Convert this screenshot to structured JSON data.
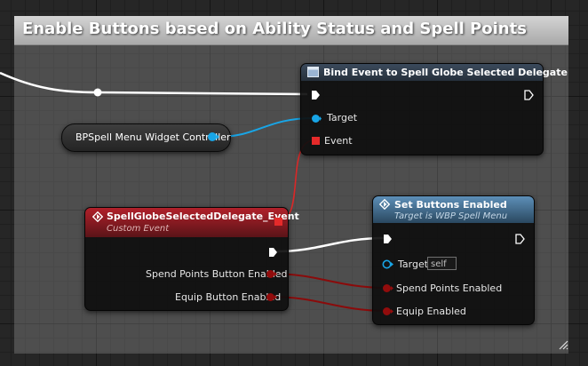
{
  "comment": {
    "title": "Enable Buttons based on Ability Status and Spell Points"
  },
  "nodes": {
    "bind_event": {
      "title": "Bind Event to Spell Globe Selected Delegate",
      "pins": {
        "target": "Target",
        "event": "Event"
      }
    },
    "getter": {
      "label": "BPSpell Menu Widget Controller"
    },
    "custom_event": {
      "title": "SpellGlobeSelectedDelegate_Event",
      "subtitle": "Custom Event",
      "pins": {
        "spend_points": "Spend Points Button Enabled",
        "equip": "Equip Button Enabled"
      }
    },
    "set_buttons": {
      "title": "Set Buttons Enabled",
      "subtitle": "Target is WBP Spell Menu",
      "pins": {
        "target": "Target",
        "target_value": "self",
        "spend_points": "Spend Points Enabled",
        "equip": "Equip Enabled"
      }
    }
  },
  "colors": {
    "exec": "#ffffff",
    "object_pin": "#18a5e6",
    "delegate_pin": "#e52a2a",
    "bool_pin": "#920c0c"
  }
}
